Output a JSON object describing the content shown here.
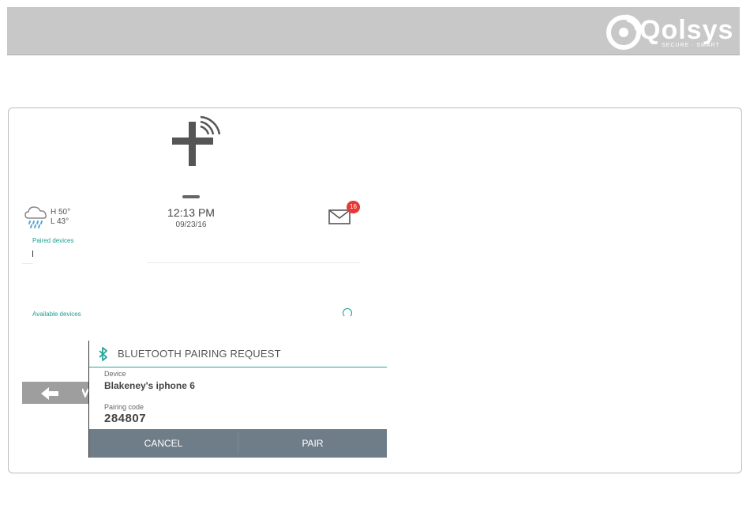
{
  "brand": {
    "logo_text": "Qolsys",
    "logo_tagline": "SECURE · SMART"
  },
  "status": {
    "weather": {
      "high": "H 50°",
      "low": "L 43°",
      "icon": "rain-cloud-icon"
    },
    "clock": {
      "time": "12:13 PM",
      "date": "09/23/16"
    },
    "messages": {
      "count": "16",
      "icon": "mail-icon"
    }
  },
  "bluetooth_panel": {
    "paired_label": "Paired devices",
    "available_label": "Available devices"
  },
  "dialog": {
    "title": "BLUETOOTH PAIRING REQUEST",
    "device_label": "Device",
    "device_value": "Blakeney's iphone 6",
    "code_label": "Pairing code",
    "code_value": "284807",
    "cancel_label": "CANCEL",
    "pair_label": "PAIR"
  },
  "colors": {
    "accent": "#26a69a",
    "label_teal": "#1a9e8f",
    "badge": "#e53935",
    "action_bar": "#6f7d89",
    "header": "#c8c8c8"
  }
}
